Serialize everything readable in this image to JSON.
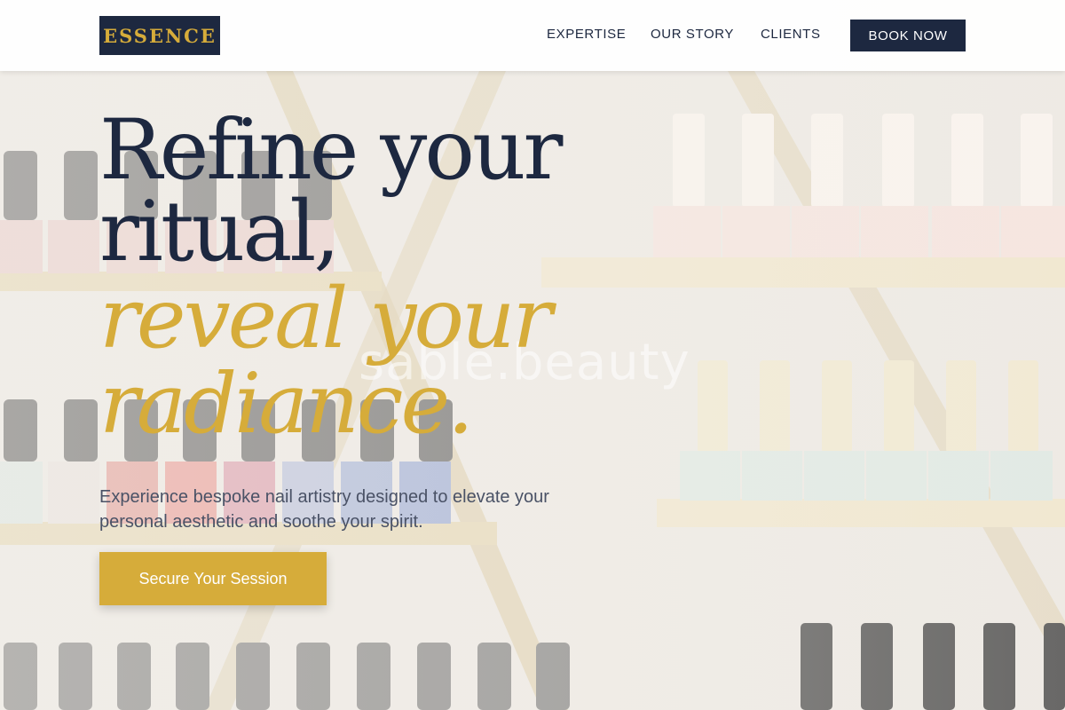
{
  "brand": {
    "logo_text": "ESSENCE"
  },
  "nav": {
    "items": [
      {
        "label": "EXPERTISE"
      },
      {
        "label": "OUR STORY"
      },
      {
        "label": "CLIENTS"
      }
    ],
    "book_label": "BOOK NOW"
  },
  "hero": {
    "line1": "Refine your",
    "line2": "ritual,",
    "line3": "reveal your",
    "line4": "radiance.",
    "subtitle": "Experience bespoke nail artistry designed to elevate your personal aesthetic and soothe your spirit.",
    "cta_label": "Secure Your Session"
  },
  "background": {
    "watermark": "sable.beauty"
  },
  "colors": {
    "navy": "#1d2840",
    "gold": "#d6ac3a",
    "body_text": "#4a5266",
    "header_bg": "#ffffff"
  }
}
